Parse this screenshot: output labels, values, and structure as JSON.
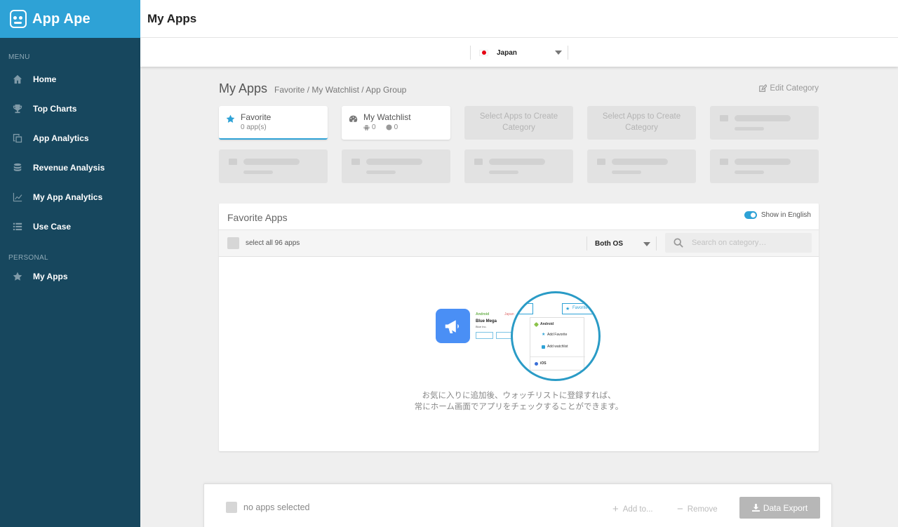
{
  "brand": {
    "name": "App Ape"
  },
  "header": {
    "title": "My Apps"
  },
  "country": {
    "selected": "Japan"
  },
  "sidebar": {
    "menu_label": "MENU",
    "items": [
      {
        "label": "Home",
        "icon": "home-icon"
      },
      {
        "label": "Top Charts",
        "icon": "trophy-icon"
      },
      {
        "label": "App Analytics",
        "icon": "copy-icon"
      },
      {
        "label": "Revenue Analysis",
        "icon": "database-icon"
      },
      {
        "label": "My App Analytics",
        "icon": "line-chart-icon"
      },
      {
        "label": "Use Case",
        "icon": "list-icon"
      }
    ],
    "personal_label": "PERSONAL",
    "personal_items": [
      {
        "label": "My Apps",
        "icon": "star-icon"
      }
    ]
  },
  "main": {
    "title": "My Apps",
    "breadcrumb": "Favorite / My Watchlist / App Group",
    "edit_category": "Edit Category"
  },
  "categories": {
    "favorite": {
      "title": "Favorite",
      "count": "0 app(s)"
    },
    "watchlist": {
      "title": "My Watchlist",
      "android_count": "0",
      "ios_count": "0"
    },
    "select_prompt": "Select Apps to Create Category"
  },
  "favorite_panel": {
    "title": "Favorite Apps",
    "show_english": "Show in English",
    "select_all": "select all 96 apps",
    "os_filter": "Both OS",
    "search_placeholder": "Search on category…",
    "message_line1": "お気に入りに追加後、ウォッチリストに登録すれば、",
    "message_line2": "常にホーム画面でアプリをチェックすることができます。",
    "illustration": {
      "android": "Android",
      "japan": "Japan",
      "app_name": "Blue Mega",
      "publisher": "Blue Inc.",
      "favorite": "Favorite",
      "menu_android": "Android",
      "add_favorite": "Add Favorite",
      "add_watchlist": "Add watchlist",
      "ios": "iOS"
    }
  },
  "bottom_bar": {
    "selection": "no apps selected",
    "add_to": "Add to...",
    "remove": "Remove",
    "export": "Data Export"
  },
  "colors": {
    "accent": "#2ea2d6",
    "sidebar": "#17475e",
    "app_tile": "#4a8ff5"
  }
}
